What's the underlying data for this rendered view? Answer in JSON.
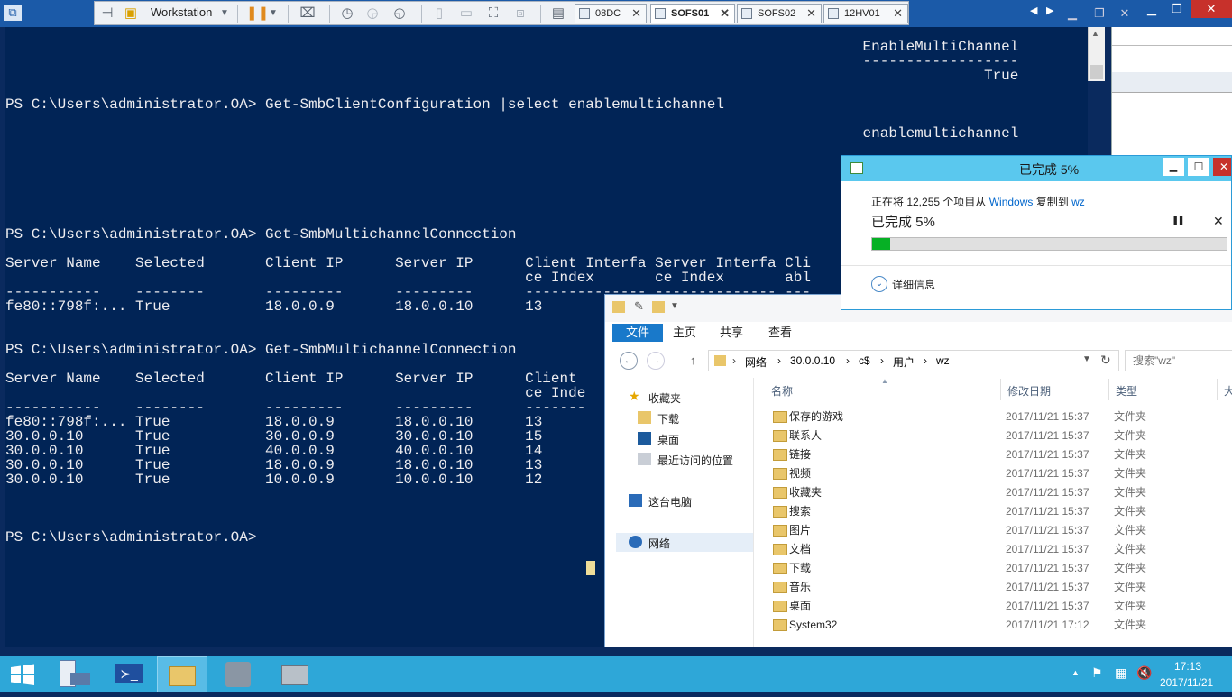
{
  "vmware": {
    "workstation_label": "Workstation",
    "tabs": [
      {
        "label": "08DC",
        "active": false
      },
      {
        "label": "SOFS01",
        "active": true
      },
      {
        "label": "SOFS02",
        "active": false
      },
      {
        "label": "12HV01",
        "active": false
      }
    ],
    "tab_close": "✕",
    "window_controls": {
      "minimize": "▁",
      "restore": "❐",
      "close": "✕"
    }
  },
  "powershell": {
    "lines": [
      {
        "text": "                                                                                                   EnableMultiChannel"
      },
      {
        "text": "                                                                                                   ------------------"
      },
      {
        "text": "                                                                                                                 True"
      },
      {
        "text": ""
      },
      {
        "text": "PS C:\\Users\\administrator.OA> Get-SmbClientConfiguration |select enablemultichannel"
      },
      {
        "text": ""
      },
      {
        "text": "                                                                                                   enablemultichannel"
      },
      {
        "text": ""
      },
      {
        "text": ""
      },
      {
        "text": ""
      },
      {
        "text": ""
      },
      {
        "text": ""
      },
      {
        "text": ""
      },
      {
        "text": "PS C:\\Users\\administrator.OA> Get-SmbMultichannelConnection"
      },
      {
        "text": ""
      },
      {
        "text": "Server Name    Selected       Client IP      Server IP      Client Interfa Server Interfa Cli"
      },
      {
        "text": "                                                            ce Index       ce Index       abl"
      },
      {
        "text": "-----------    --------       ---------      ---------      -------------- -------------- ---"
      },
      {
        "text": "fe80::798f:... True           18.0.0.9       18.0.0.10      13             16             Tru"
      },
      {
        "text": ""
      },
      {
        "text": ""
      },
      {
        "text": "PS C:\\Users\\administrator.OA> Get-SmbMultichannelConnection"
      },
      {
        "text": ""
      },
      {
        "text": "Server Name    Selected       Client IP      Server IP      Client"
      },
      {
        "text": "                                                            ce Inde"
      },
      {
        "text": "-----------    --------       ---------      ---------      -------"
      },
      {
        "text": "fe80::798f:... True           18.0.0.9       18.0.0.10      13"
      },
      {
        "text": "30.0.0.10      True           30.0.0.9       30.0.0.10      15"
      },
      {
        "text": "30.0.0.10      True           40.0.0.9       40.0.0.10      14"
      },
      {
        "text": "30.0.0.10      True           18.0.0.9       18.0.0.10      13"
      },
      {
        "text": "30.0.0.10      True           10.0.0.9       10.0.0.10      12"
      },
      {
        "text": ""
      },
      {
        "text": ""
      },
      {
        "text": ""
      },
      {
        "text": "PS C:\\Users\\administrator.OA>"
      }
    ]
  },
  "copy_dialog": {
    "title": "已完成 5%",
    "status_prefix": "正在将 12,255 个项目从 ",
    "source": "Windows",
    "status_mid": " 复制到 ",
    "dest": "wz",
    "percent_label": "已完成 5%",
    "progress": 0.05,
    "pause": "❚❚",
    "close": "✕",
    "details_label": "详细信息",
    "win_min": "▁",
    "win_max": "☐",
    "win_close": "✕"
  },
  "explorer": {
    "ribbon_tabs": [
      "文件",
      "主页",
      "共享",
      "查看"
    ],
    "breadcrumb": [
      "网络",
      "30.0.0.10",
      "c$",
      "用户",
      "wz"
    ],
    "search_placeholder": "搜索\"wz\"",
    "columns": {
      "name": "名称",
      "date": "修改日期",
      "type": "类型",
      "size": "大"
    },
    "nav": {
      "favorites": "收藏夹",
      "downloads": "下载",
      "desktop": "桌面",
      "recent": "最近访问的位置",
      "this_pc": "这台电脑",
      "network": "网络"
    },
    "files": [
      {
        "name": "保存的游戏",
        "date": "2017/11/21 15:37",
        "type": "文件夹"
      },
      {
        "name": "联系人",
        "date": "2017/11/21 15:37",
        "type": "文件夹"
      },
      {
        "name": "链接",
        "date": "2017/11/21 15:37",
        "type": "文件夹"
      },
      {
        "name": "视频",
        "date": "2017/11/21 15:37",
        "type": "文件夹"
      },
      {
        "name": "收藏夹",
        "date": "2017/11/21 15:37",
        "type": "文件夹"
      },
      {
        "name": "搜索",
        "date": "2017/11/21 15:37",
        "type": "文件夹"
      },
      {
        "name": "图片",
        "date": "2017/11/21 15:37",
        "type": "文件夹"
      },
      {
        "name": "文档",
        "date": "2017/11/21 15:37",
        "type": "文件夹"
      },
      {
        "name": "下载",
        "date": "2017/11/21 15:37",
        "type": "文件夹"
      },
      {
        "name": "音乐",
        "date": "2017/11/21 15:37",
        "type": "文件夹"
      },
      {
        "name": "桌面",
        "date": "2017/11/21 15:37",
        "type": "文件夹"
      },
      {
        "name": "System32",
        "date": "2017/11/21 17:12",
        "type": "文件夹"
      }
    ]
  },
  "taskbar": {
    "time": "17:13",
    "date": "2017/11/21",
    "tray_arrow": "▲"
  },
  "colors": {
    "ps_bg": "#012456",
    "ps_text": "#eeedf0",
    "taskbar": "#2ea7d8",
    "progress_fill": "#06b025",
    "dialog_title": "#5ac8ee"
  }
}
